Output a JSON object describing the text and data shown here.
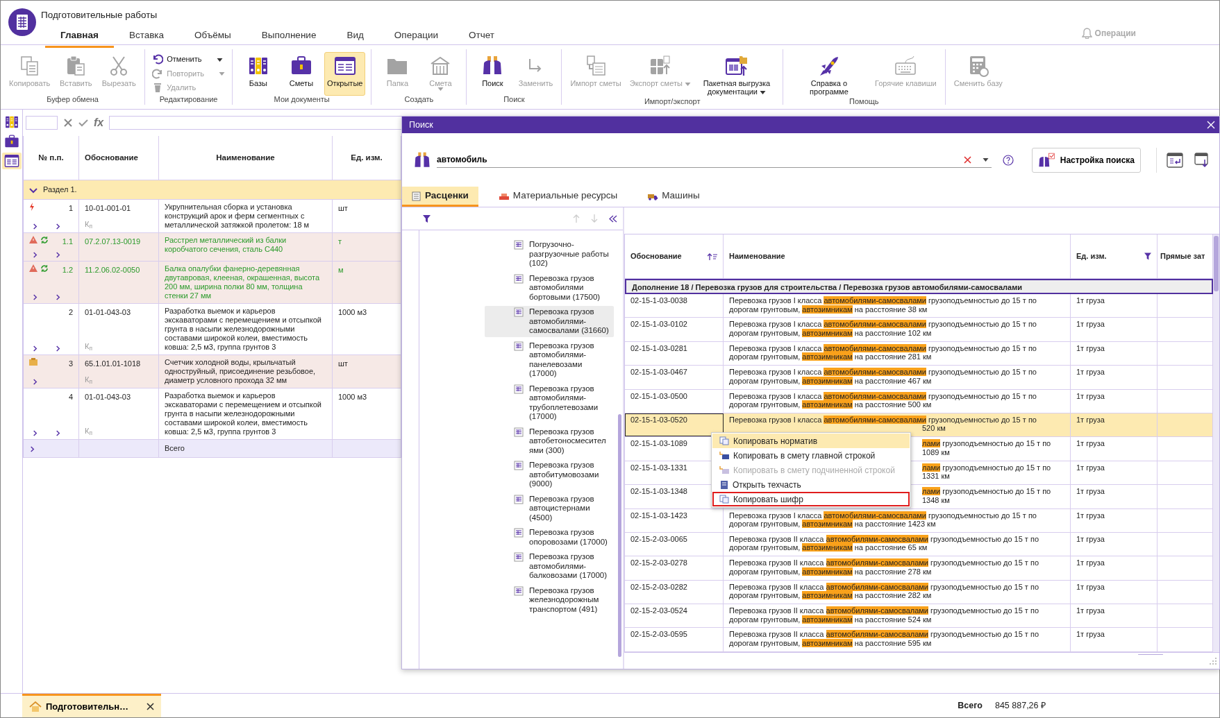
{
  "app": {
    "title": "Подготовительные работы",
    "notifications": "Операции"
  },
  "menu_tabs": [
    {
      "label": "Главная",
      "selected": true
    },
    {
      "label": "Вставка",
      "selected": false
    },
    {
      "label": "Объёмы",
      "selected": false
    },
    {
      "label": "Выполнение",
      "selected": false
    },
    {
      "label": "Вид",
      "selected": false
    },
    {
      "label": "Операции",
      "selected": false
    },
    {
      "label": "Отчет",
      "selected": false
    }
  ],
  "ribbon": [
    {
      "label": "Буфер обмена",
      "kind": "large",
      "buttons": [
        {
          "label": "Копировать",
          "disabled": true
        },
        {
          "label": "Вставить",
          "disabled": true
        },
        {
          "label": "Вырезать",
          "disabled": true
        }
      ]
    },
    {
      "label": "Редактирование",
      "kind": "compact",
      "buttons": [
        {
          "label": "Отменить",
          "disabled": false,
          "dropdown": true
        },
        {
          "label": "Повторить",
          "disabled": true,
          "dropdown": true
        },
        {
          "label": "Удалить",
          "disabled": true
        }
      ]
    },
    {
      "label": "Мои документы",
      "kind": "large",
      "buttons": [
        {
          "label": "Базы",
          "disabled": false,
          "selected": false
        },
        {
          "label": "Сметы",
          "disabled": false,
          "selected": false
        },
        {
          "label": "Открытые",
          "disabled": false,
          "selected": true
        }
      ]
    },
    {
      "label": "Создать",
      "kind": "large",
      "buttons": [
        {
          "label": "Папка",
          "disabled": true
        },
        {
          "label": "Смета",
          "disabled": true,
          "dropdown": true,
          "caret_below": true
        }
      ]
    },
    {
      "label": "Поиск",
      "kind": "large",
      "buttons": [
        {
          "label": "Поиск",
          "disabled": false
        },
        {
          "label": "Заменить",
          "disabled": true
        }
      ]
    },
    {
      "label": "Импорт/экспорт",
      "kind": "large",
      "buttons": [
        {
          "label": "Импорт сметы",
          "disabled": true
        },
        {
          "label": "Экспорт сметы",
          "disabled": true,
          "dropdown": true
        },
        {
          "label": "Пакетная выгрузка документации",
          "disabled": false,
          "dropdown": true
        }
      ]
    },
    {
      "label": "Помощь",
      "kind": "large",
      "buttons": [
        {
          "label": "Справка о программе",
          "disabled": false
        },
        {
          "label": "Горячие клавиши",
          "disabled": true
        }
      ]
    },
    {
      "kind": "large",
      "buttons": [
        {
          "label": "Сменить базу",
          "disabled": true
        }
      ]
    }
  ],
  "side_tools": [
    {
      "selected": false
    },
    {
      "selected": false
    },
    {
      "selected": true
    }
  ],
  "formula_bar": {
    "function_label": "fx"
  },
  "estimate_table": {
    "columns": [
      "№ п.п.",
      "Обоснование",
      "Наименование",
      "Ед. изм."
    ],
    "section": {
      "label": "Раздел 1.",
      "expanded": true
    },
    "rows": [
      {
        "kind": "work",
        "number": "1",
        "code": "10-01-001-01",
        "name": "Укрупнительная сборка и установка конструкций арок и ферм сегментных с металлической затяжкой пролетом: 18 м",
        "unit": "шт",
        "coefficient": "К$_{п}$",
        "alert": true,
        "warning": false,
        "refreshed": false,
        "expanders": [
          {
            "expanded": false
          },
          {
            "expanded": false
          }
        ]
      },
      {
        "kind": "material",
        "number": "1.1",
        "code": "07.2.07.13-0019",
        "name": "Расстрел металлический из балки коробчатого сечения, сталь С440",
        "unit": "т",
        "alert": false,
        "warning": true,
        "refreshed": true,
        "expanders": [
          {
            "expanded": false
          },
          {
            "expanded": false
          }
        ]
      },
      {
        "kind": "material",
        "number": "1.2",
        "code": "11.2.06.02-0050",
        "name": "Балка опалубки фанерно-деревянная двутавровая, клееная, окрашенная, высота 200 мм, ширина полки 80 мм, толщина стенки 27 мм",
        "unit": "м",
        "alert": false,
        "warning": true,
        "refreshed": true,
        "expanders": [
          {
            "expanded": false
          },
          {
            "expanded": false
          }
        ]
      },
      {
        "kind": "work",
        "number": "2",
        "code": "01-01-043-03",
        "name": "Разработка выемок и карьеров экскаваторами с перемещением и отсыпкой грунта в насыпи железнодорожными составами широкой колеи, вместимость ковша: 2,5 м3, группа грунтов 3",
        "unit": "1000 м3",
        "coefficient": "К$_{п}$",
        "alert": false,
        "warning": false,
        "refreshed": false,
        "expanders": [
          {
            "expanded": false
          },
          {
            "expanded": false
          }
        ]
      },
      {
        "kind": "equipment",
        "number": "3",
        "code": "65.1.01.01-1018",
        "name": "Счетчик холодной воды, крыльчатый одноструйный, присоединение резьбовое, диаметр условного прохода 32 мм",
        "unit": "шт",
        "coefficient": "К$_{п}$",
        "alert": false,
        "warning": false,
        "refreshed": false,
        "expanders": [
          {
            "expanded": false
          }
        ]
      },
      {
        "kind": "work",
        "number": "4",
        "code": "01-01-043-03",
        "name": "Разработка выемок и карьеров экскаваторами с перемещением и отсыпкой грунта в насыпи железнодорожными составами широкой колеи, вместимость ковша: 2,5 м3, группа грунтов 3",
        "unit": "1000 м3",
        "coefficient": "К$_{п}$",
        "alert": false,
        "warning": false,
        "refreshed": false,
        "expanders": [
          {
            "expanded": false
          },
          {
            "expanded": false
          }
        ]
      }
    ],
    "total": {
      "label": "Всего",
      "expanders": [
        {
          "expanded": false
        }
      ]
    }
  },
  "search_dialog": {
    "title": "Поиск",
    "query": "автомобиль",
    "settings_button": "Настройка поиска",
    "tabs": [
      {
        "label": "Расценки",
        "selected": true
      },
      {
        "label": "Материальные ресурсы",
        "selected": false
      },
      {
        "label": "Машины",
        "selected": false
      }
    ],
    "tree": [
      {
        "label": "Погрузочно-разгрузочные работы (102)",
        "selected": false
      },
      {
        "label": "Перевозка грузов автомобилями бортовыми (17500)",
        "selected": false
      },
      {
        "label": "Перевозка грузов автомобилями-самосвалами (31660)",
        "selected": true
      },
      {
        "label": "Перевозка грузов автомобилями-панелевозами (17000)",
        "selected": false
      },
      {
        "label": "Перевозка грузов автомобилями-трубоплетевозами (17000)",
        "selected": false
      },
      {
        "label": "Перевозка грузов автобетоносмесителями (300)",
        "selected": false
      },
      {
        "label": "Перевозка грузов автобитумовозами (9000)",
        "selected": false
      },
      {
        "label": "Перевозка грузов автоцистернами (4500)",
        "selected": false
      },
      {
        "label": "Перевозка грузов опоровозами (17000)",
        "selected": false
      },
      {
        "label": "Перевозка грузов автомобилями-балковозами (17000)",
        "selected": false
      },
      {
        "label": "Перевозка грузов железнодорожным транспортом (491)",
        "selected": false
      }
    ],
    "results": {
      "columns": [
        "Обоснование",
        "Наименование",
        "Ед. изм.",
        "Прямые зат"
      ],
      "group": "Дополнение 18 / Перевозка грузов для строительства / Перевозка грузов автомобилями-самосвалами",
      "rows": [
        {
          "code": "02-15-1-03-0038",
          "name": "Перевозка грузов I класса **автомобилями-самосвалами** грузоподъемностью до 15 т по дорогам грунтовым, **автозимникам** на расстояние 38 км",
          "unit": "1т груза",
          "selected": false
        },
        {
          "code": "02-15-1-03-0102",
          "name": "Перевозка грузов I класса **автомобилями-самосвалами** грузоподъемностью до 15 т по дорогам грунтовым, **автозимникам** на расстояние 102 км",
          "unit": "1т груза",
          "selected": false
        },
        {
          "code": "02-15-1-03-0281",
          "name": "Перевозка грузов I класса **автомобилями-самосвалами** грузоподъемностью до 15 т по дорогам грунтовым, **автозимникам** на расстояние 281 км",
          "unit": "1т груза",
          "selected": false
        },
        {
          "code": "02-15-1-03-0467",
          "name": "Перевозка грузов I класса **автомобилями-самосвалами** грузоподъемностью до 15 т по дорогам грунтовым, **автозимникам** на расстояние 467 км",
          "unit": "1т груза",
          "selected": false
        },
        {
          "code": "02-15-1-03-0500",
          "name": "Перевозка грузов I класса **автомобилями-самосвалами** грузоподъемностью до 15 т по дорогам грунтовым, **автозимникам** на расстояние 500 км",
          "unit": "1т груза",
          "selected": false
        },
        {
          "code": "02-15-1-03-0520",
          "name_lines": [
            {
              "text": "Перевозка грузов I класса **автомобилями-самосвалами** грузоподъемностью до 15 т по",
              "indented": false
            },
            {
              "text": "520 км",
              "indented": true
            }
          ],
          "unit": "1т груза",
          "selected": true
        },
        {
          "code": "02-15-1-03-1089",
          "name_lines": [
            {
              "text": "**лами** грузоподъемностью до 15 т по",
              "indented": true
            },
            {
              "text": "1089 км",
              "indented": true
            }
          ],
          "unit": "1т груза",
          "selected": false
        },
        {
          "code": "02-15-1-03-1331",
          "name_lines": [
            {
              "text": "**лами** грузоподъемностью до 15 т по",
              "indented": true
            },
            {
              "text": "1331 км",
              "indented": true
            }
          ],
          "unit": "1т груза",
          "selected": false
        },
        {
          "code": "02-15-1-03-1348",
          "name_lines": [
            {
              "text": "**лами** грузоподъемностью до 15 т по",
              "indented": true
            },
            {
              "text": "1348 км",
              "indented": true
            }
          ],
          "unit": "1т груза",
          "selected": false
        },
        {
          "code": "02-15-1-03-1423",
          "name": "Перевозка грузов I класса **автомобилями-самосвалами** грузоподъемностью до 15 т по дорогам грунтовым, **автозимникам** на расстояние 1423 км",
          "unit": "1т груза",
          "selected": false
        },
        {
          "code": "02-15-2-03-0065",
          "name": "Перевозка грузов II класса **автомобилями-самосвалами** грузоподъемностью до 15 т по дорогам грунтовым, **автозимникам** на расстояние 65 км",
          "unit": "1т груза",
          "selected": false
        },
        {
          "code": "02-15-2-03-0278",
          "name": "Перевозка грузов II класса **автомобилями-самосвалами** грузоподъемностью до 15 т по дорогам грунтовым, **автозимникам** на расстояние 278 км",
          "unit": "1т груза",
          "selected": false
        },
        {
          "code": "02-15-2-03-0282",
          "name": "Перевозка грузов II класса **автомобилями-самосвалами** грузоподъемностью до 15 т по дорогам грунтовым, **автозимникам** на расстояние 282 км",
          "unit": "1т груза",
          "selected": false
        },
        {
          "code": "02-15-2-03-0524",
          "name": "Перевозка грузов II класса **автомобилями-самосвалами** грузоподъемностью до 15 т по дорогам грунтовым, **автозимникам** на расстояние 524 км",
          "unit": "1т груза",
          "selected": false
        },
        {
          "code": "02-15-2-03-0595",
          "name": "Перевозка грузов II класса **автомобилями-самосвалами** грузоподъемностью до 15 т по дорогам грунтовым, **автозимникам** на расстояние 595 км",
          "unit": "1т груза",
          "selected": false
        }
      ]
    },
    "context_menu": [
      {
        "label": "Копировать норматив",
        "hovered": true,
        "disabled": false,
        "outlined": false
      },
      {
        "label": "Копировать в смету главной строкой",
        "hovered": false,
        "disabled": false,
        "outlined": false
      },
      {
        "label": "Копировать в смету подчиненной строкой",
        "hovered": false,
        "disabled": true,
        "outlined": false
      },
      {
        "label": "Открыть техчасть",
        "hovered": false,
        "disabled": false,
        "outlined": false
      },
      {
        "label": "Копировать шифр",
        "hovered": false,
        "disabled": false,
        "outlined": true
      }
    ]
  },
  "document_tabs": [
    {
      "label": "Подготовительн…",
      "selected": true
    }
  ],
  "status_bar": {
    "label": "Всего",
    "value": "845 887,26 ₽"
  }
}
